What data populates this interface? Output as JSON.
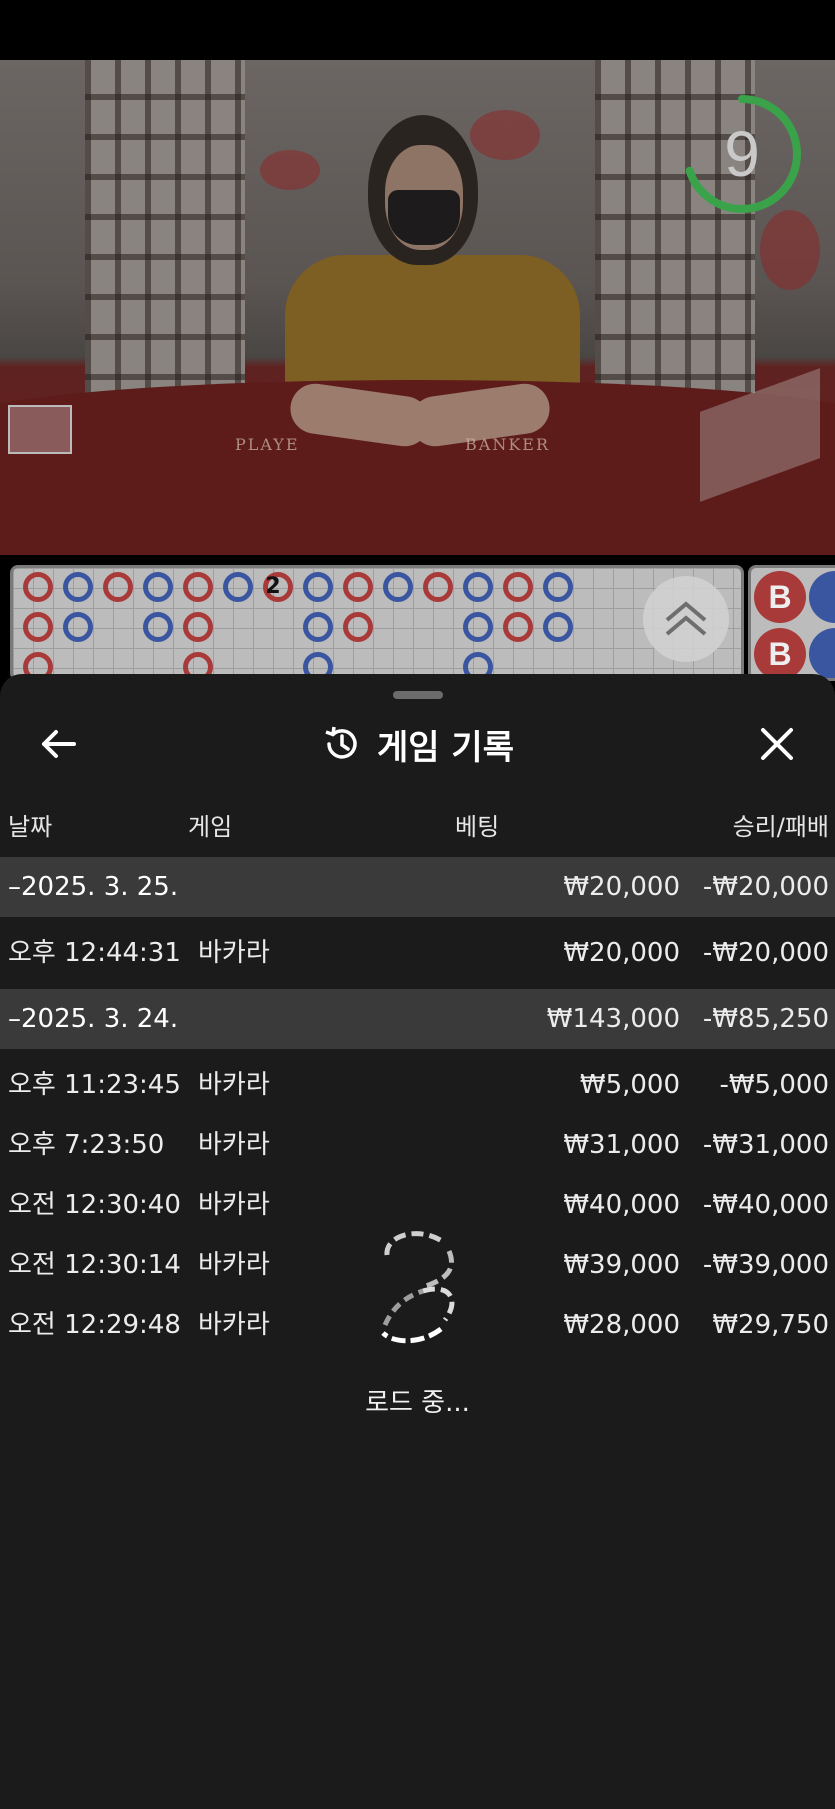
{
  "video": {
    "table_labels": {
      "player": "PLAYE",
      "banker": "BANKER"
    },
    "countdown": "9",
    "countdown_fraction": 0.7,
    "colors": {
      "timer_ring": "#3aa34a"
    }
  },
  "roadmap": {
    "tie_count": "2",
    "side_markers": [
      "B",
      "B"
    ]
  },
  "sheet": {
    "title": "게임 기록",
    "title_icon": "history-icon",
    "back_icon": "arrow-left-icon",
    "close_icon": "close-icon",
    "columns": {
      "date": "날짜",
      "game": "게임",
      "bet": "베팅",
      "result": "승리/패배"
    },
    "groups": [
      {
        "date": "–2025. 3. 25.",
        "bet_total": "₩20,000",
        "result_total": "-₩20,000",
        "rows": [
          {
            "time": "오후 12:44:31",
            "game": "바카라",
            "bet": "₩20,000",
            "result": "-₩20,000"
          }
        ]
      },
      {
        "date": "–2025. 3. 24.",
        "bet_total": "₩143,000",
        "result_total": "-₩85,250",
        "rows": [
          {
            "time": "오후 11:23:45",
            "game": "바카라",
            "bet": "₩5,000",
            "result": "-₩5,000"
          },
          {
            "time": "오후 7:23:50",
            "game": "바카라",
            "bet": "₩31,000",
            "result": "-₩31,000"
          },
          {
            "time": "오전 12:30:40",
            "game": "바카라",
            "bet": "₩40,000",
            "result": "-₩40,000"
          },
          {
            "time": "오전 12:30:14",
            "game": "바카라",
            "bet": "₩39,000",
            "result": "-₩39,000"
          },
          {
            "time": "오전 12:29:48",
            "game": "바카라",
            "bet": "₩28,000",
            "result": "₩29,750"
          }
        ]
      }
    ],
    "loading_text": "로드 중..."
  }
}
